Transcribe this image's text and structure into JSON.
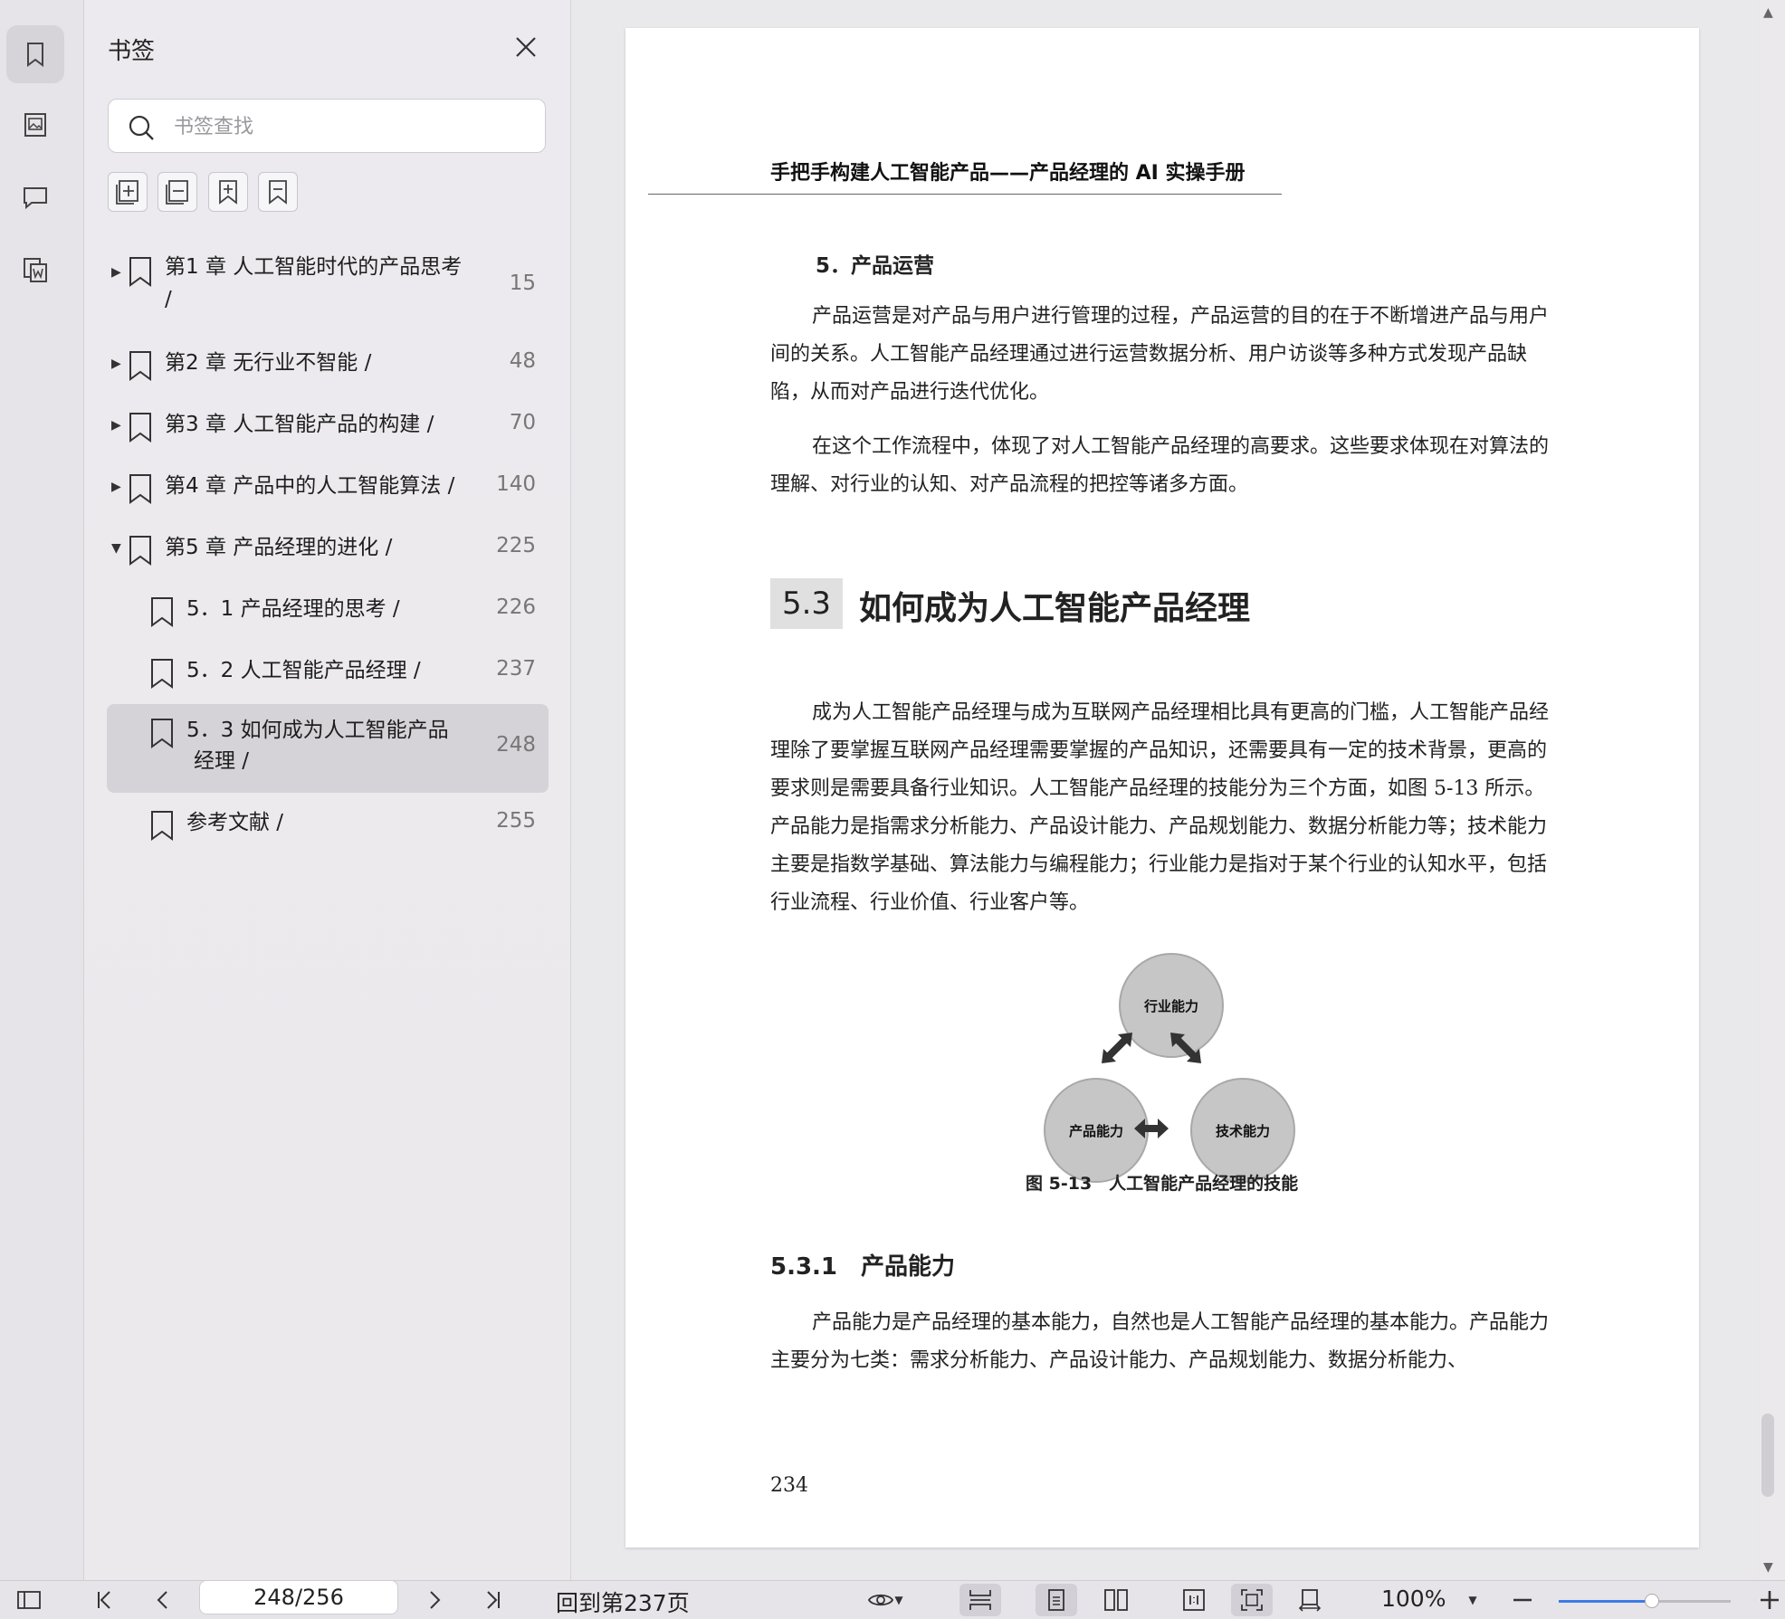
{
  "sidebar_panel": {
    "title": "书签",
    "search_placeholder": "书签查找"
  },
  "bookmarks": [
    {
      "label_line1": "第1 章 人工智能时代的产品思考",
      "label_line2": "/",
      "page": "15",
      "expanded": false
    },
    {
      "label_line1": "第2 章 无行业不智能 /",
      "page": "48",
      "expanded": false
    },
    {
      "label_line1": "第3 章 人工智能产品的构建 /",
      "page": "70",
      "expanded": false
    },
    {
      "label_line1": "第4 章 产品中的人工智能算法 /",
      "page": "140",
      "expanded": false
    },
    {
      "label_line1": "第5 章 产品经理的进化 /",
      "page": "225",
      "expanded": true
    },
    {
      "label_line1": "5．1 产品经理的思考 /",
      "page": "226"
    },
    {
      "label_line1": "5．2 人工智能产品经理 /",
      "page": "237"
    },
    {
      "label_line1": "5．3 如何成为人工智能产品",
      "label_line2": "经理 /",
      "page": "248",
      "selected": true
    },
    {
      "label_line1": "参考文献 /",
      "page": "255"
    }
  ],
  "document": {
    "running_header": "手把手构建人工智能产品——产品经理的 AI 实操手册",
    "subheading_5": "5．产品运营",
    "para_1": "产品运营是对产品与用户进行管理的过程，产品运营的目的在于不断增进产品与用户间的关系。人工智能产品经理通过进行运营数据分析、用户访谈等多种方式发现产品缺陷，从而对产品进行迭代优化。",
    "para_2": "在这个工作流程中，体现了对人工智能产品经理的高要求。这些要求体现在对算法的理解、对行业的认知、对产品流程的把控等诸多方面。",
    "section_number": "5.3",
    "section_title": "如何成为人工智能产品经理",
    "para_3": "成为人工智能产品经理与成为互联网产品经理相比具有更高的门槛，人工智能产品经理除了要掌握互联网产品经理需要掌握的产品知识，还需要具有一定的技术背景，更高的要求则是需要具备行业知识。人工智能产品经理的技能分为三个方面，如图 5-13 所示。产品能力是指需求分析能力、产品设计能力、产品规划能力、数据分析能力等；技术能力主要是指数学基础、算法能力与编程能力；行业能力是指对于某个行业的认知水平，包括行业流程、行业价值、行业客户等。",
    "figure": {
      "top": "行业能力",
      "left": "产品能力",
      "right": "技术能力",
      "caption": "图 5-13　人工智能产品经理的技能"
    },
    "subsection": "5.3.1　产品能力",
    "para_4": "产品能力是产品经理的基本能力，自然也是人工智能产品经理的基本能力。产品能力主要分为七类：需求分析能力、产品设计能力、产品规划能力、数据分析能力、",
    "page_number": "234"
  },
  "toolbar": {
    "page_field": "248/256",
    "goto_label": "回到第237页",
    "zoom": "100%",
    "zoom_slider_fraction": 0.54
  },
  "icons": {
    "rail": [
      "bookmark-icon",
      "thumbnail-icon",
      "comment-icon",
      "attachment-icon"
    ],
    "panel_tools": [
      "expand-all-icon",
      "collapse-all-icon",
      "add-bookmark-icon",
      "remove-bookmark-icon"
    ]
  },
  "colors": {
    "accent": "#3d7be8",
    "selected_row": "#d5d3d8"
  }
}
